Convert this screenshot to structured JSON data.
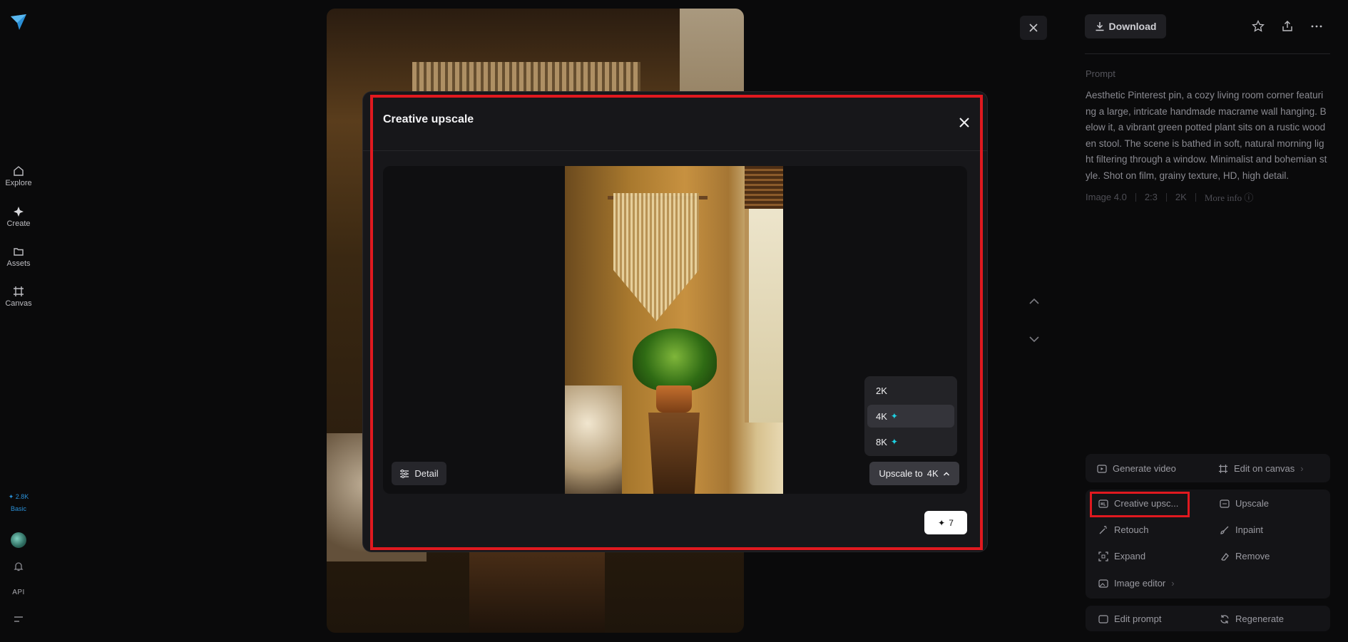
{
  "sidebar": {
    "items": [
      {
        "label": "Explore",
        "icon": "home-icon"
      },
      {
        "label": "Create",
        "icon": "sparkle-icon"
      },
      {
        "label": "Assets",
        "icon": "folder-icon"
      },
      {
        "label": "Canvas",
        "icon": "canvas-icon"
      }
    ],
    "credits": "✦ 2.8K",
    "plan": "Basic",
    "api": "API"
  },
  "right_panel": {
    "download_label": "Download",
    "prompt_label": "Prompt",
    "prompt_text": "Aesthetic Pinterest pin, a cozy living room corner featuring a large, intricate handmade macrame wall hanging. Below it, a vibrant green potted plant sits on a rustic wooden stool. The scene is bathed in soft, natural morning light filtering through a window. Minimalist and bohemian style. Shot on film, grainy texture, HD, high detail.",
    "meta": [
      "Image 4.0",
      "2:3",
      "2K",
      "More info"
    ],
    "tools": {
      "generate_video": "Generate video",
      "edit_on_canvas": "Edit on canvas",
      "creative_upscale": "Creative upsc...",
      "upscale": "Upscale",
      "retouch": "Retouch",
      "inpaint": "Inpaint",
      "expand": "Expand",
      "remove": "Remove",
      "image_editor": "Image editor",
      "edit_prompt": "Edit prompt",
      "regenerate": "Regenerate"
    }
  },
  "modal": {
    "title": "Creative upscale",
    "detail_label": "Detail",
    "upscale_prefix": "Upscale to",
    "upscale_value": "4K",
    "options": [
      "2K",
      "4K",
      "8K"
    ],
    "selected_option": "4K",
    "generate_cost": "7"
  },
  "colors": {
    "highlight": "#e0191f",
    "sparkle": "#1ecfe0",
    "credits": "#2a8fd6"
  }
}
